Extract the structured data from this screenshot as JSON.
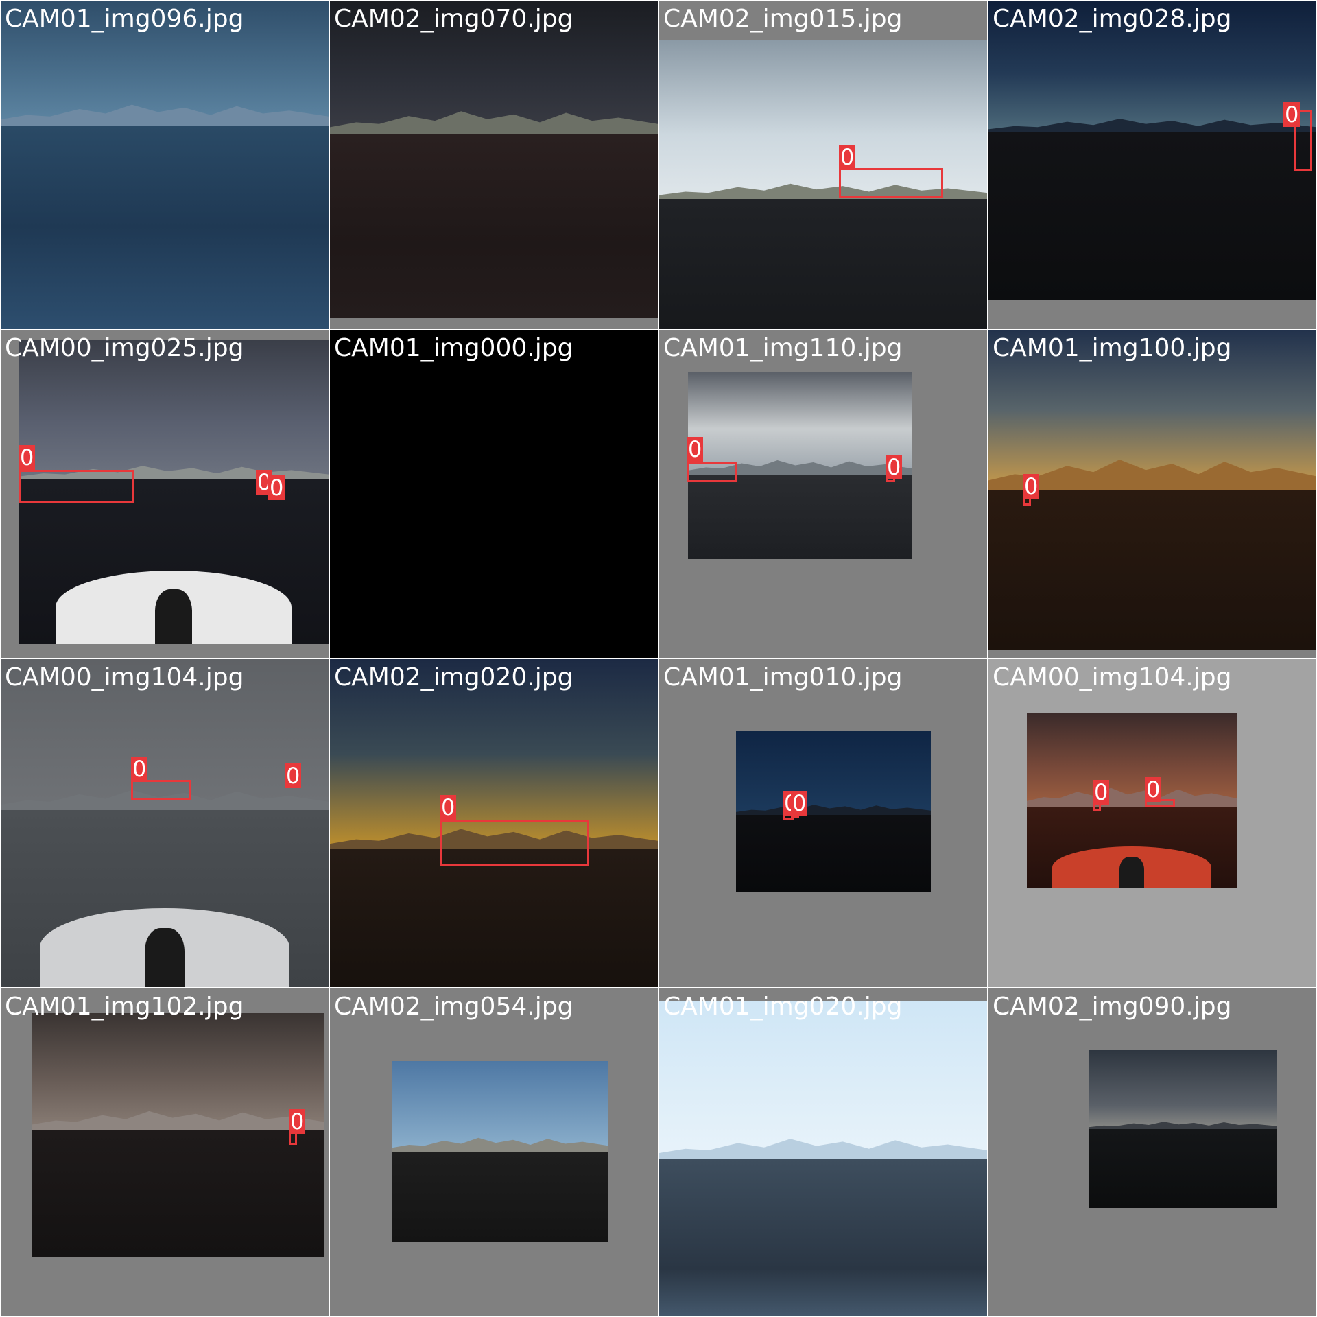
{
  "mosaic": {
    "background": "#ffffff",
    "pad_color": "#808080",
    "box_color": "#e8383b",
    "tiles": [
      {
        "filename": "CAM01_img096.jpg",
        "scene": "blue-sea-mountains",
        "pad": "none",
        "detections": []
      },
      {
        "filename": "CAM02_img070.jpg",
        "scene": "dark-storm-sea",
        "pad": "bottom",
        "detections": []
      },
      {
        "filename": "CAM02_img015.jpg",
        "scene": "overcast-mountain-ship",
        "pad": "top-bottom",
        "detections": [
          {
            "label": "0"
          }
        ]
      },
      {
        "filename": "CAM02_img028.jpg",
        "scene": "dusk-dark-sea",
        "pad": "bottom",
        "detections": [
          {
            "label": "0"
          }
        ]
      },
      {
        "filename": "CAM00_img025.jpg",
        "scene": "rainy-bow-ship",
        "pad": "left-bottom",
        "detections": [
          {
            "label": "0"
          },
          {
            "label": "0"
          },
          {
            "label": "0"
          }
        ]
      },
      {
        "filename": "CAM01_img000.jpg",
        "scene": "black-frame",
        "pad": "none",
        "detections": []
      },
      {
        "filename": "CAM01_img110.jpg",
        "scene": "cloudy-sea-ship",
        "pad": "all-large",
        "detections": [
          {
            "label": "0"
          },
          {
            "label": "0"
          }
        ]
      },
      {
        "filename": "CAM01_img100.jpg",
        "scene": "sunset-mountains",
        "pad": "bottom-small",
        "detections": [
          {
            "label": "0"
          }
        ]
      },
      {
        "filename": "CAM00_img104.jpg",
        "scene": "grey-fog-bow",
        "pad": "none",
        "detections": [
          {
            "label": "0"
          },
          {
            "label": "0"
          }
        ]
      },
      {
        "filename": "CAM02_img020.jpg",
        "scene": "golden-dusk-ship",
        "pad": "none",
        "detections": [
          {
            "label": "0"
          }
        ]
      },
      {
        "filename": "CAM01_img010.jpg",
        "scene": "night-mountains",
        "pad": "all-large",
        "detections": [
          {
            "label": "0"
          },
          {
            "label": "0"
          }
        ]
      },
      {
        "filename": "CAM00_img104.jpg",
        "scene": "red-dusk-bow",
        "pad": "all-large-light",
        "detections": [
          {
            "label": "0"
          },
          {
            "label": "0"
          }
        ]
      },
      {
        "filename": "CAM01_img102.jpg",
        "scene": "brown-clouds-sea",
        "pad": "all-medium",
        "detections": [
          {
            "label": "0"
          }
        ]
      },
      {
        "filename": "CAM02_img054.jpg",
        "scene": "clear-sky-sea",
        "pad": "all-large",
        "detections": []
      },
      {
        "filename": "CAM01_img020.jpg",
        "scene": "bright-sky-sea",
        "pad": "top",
        "detections": []
      },
      {
        "filename": "CAM02_img090.jpg",
        "scene": "dusk-sea-spray",
        "pad": "all-large",
        "detections": []
      }
    ]
  }
}
